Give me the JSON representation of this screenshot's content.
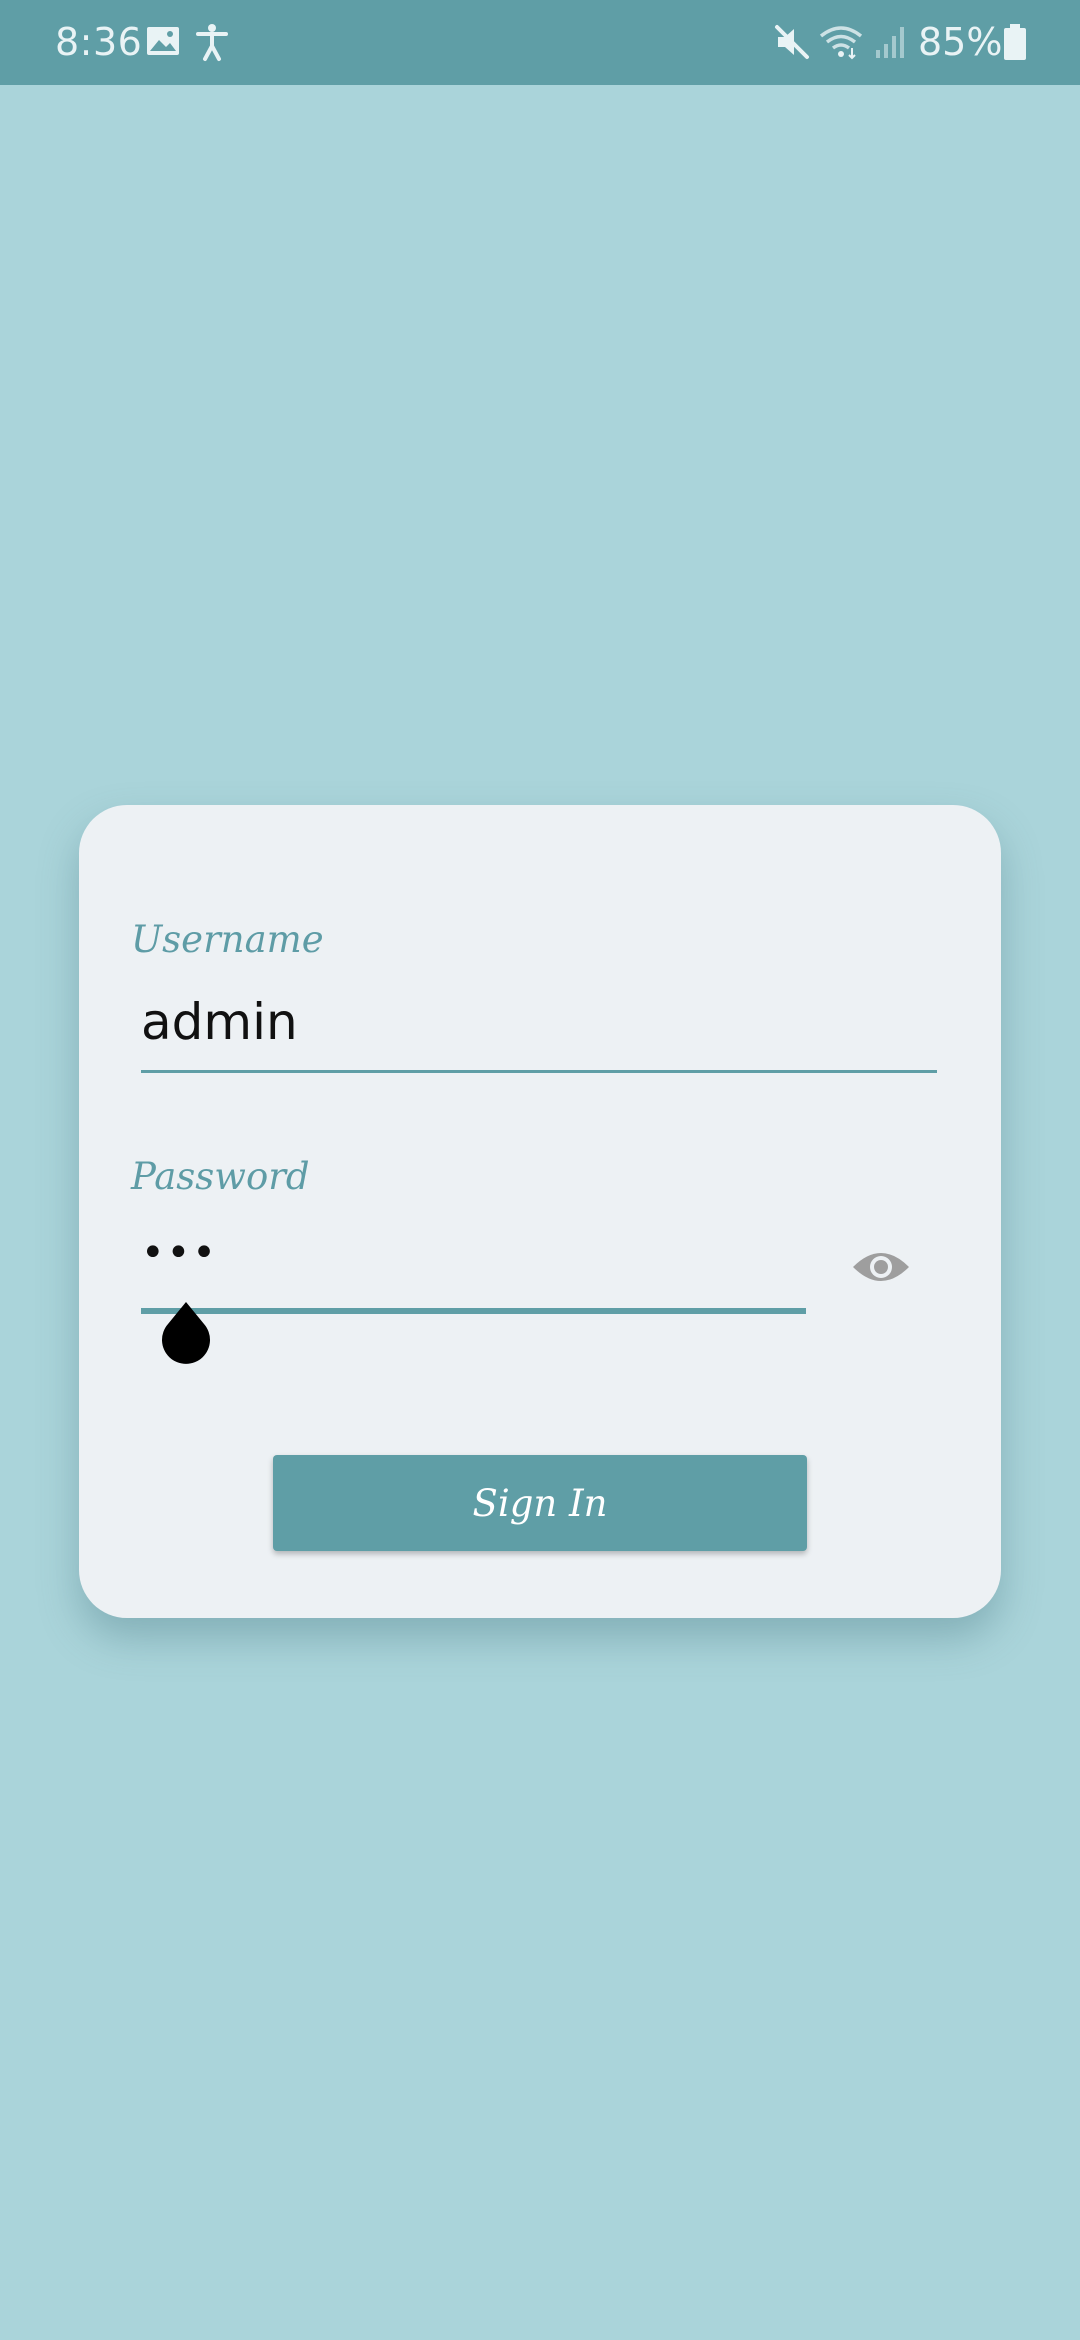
{
  "status_bar": {
    "time": "8:36",
    "battery_percent": "85%",
    "icons": [
      "gallery-icon",
      "accessibility-icon",
      "mute-icon",
      "wifi-icon",
      "signal-icon",
      "battery-icon"
    ]
  },
  "login": {
    "username_label": "Username",
    "username_value": "admin",
    "password_label": "Password",
    "password_value": "•••",
    "sign_in_label": "Sign In"
  },
  "colors": {
    "background": "#aad4da",
    "status_bar": "#5f9ea6",
    "card": "#edf1f4",
    "accent": "#5f9ea6"
  }
}
